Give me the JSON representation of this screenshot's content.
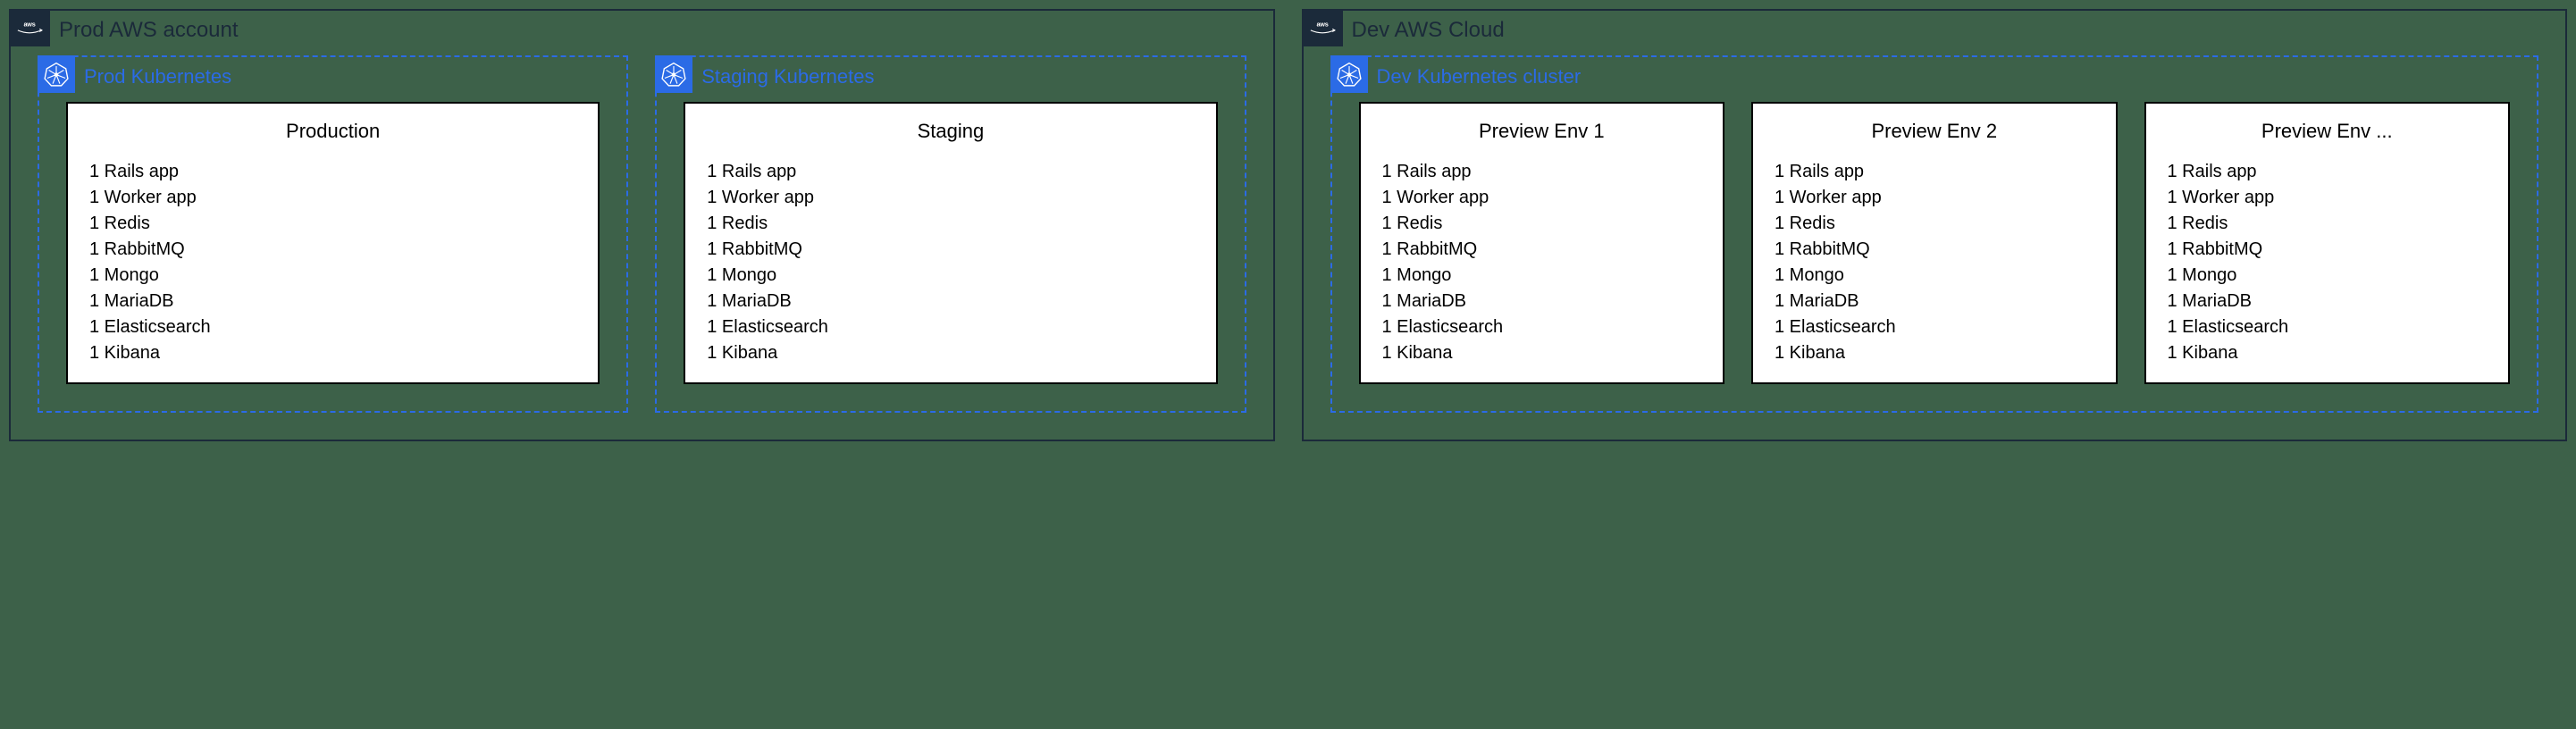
{
  "accounts": [
    {
      "id": "prod-account",
      "title": "Prod AWS account",
      "clusters": [
        {
          "id": "prod-k8s",
          "title": "Prod Kubernetes",
          "environments": [
            {
              "name": "Production",
              "items": [
                "1 Rails app",
                "1 Worker app",
                "1 Redis",
                "1 RabbitMQ",
                "1 Mongo",
                "1 MariaDB",
                "1 Elasticsearch",
                "1 Kibana"
              ]
            }
          ]
        },
        {
          "id": "staging-k8s",
          "title": "Staging Kubernetes",
          "environments": [
            {
              "name": "Staging",
              "items": [
                "1 Rails app",
                "1 Worker app",
                "1 Redis",
                "1 RabbitMQ",
                "1 Mongo",
                "1 MariaDB",
                "1 Elasticsearch",
                "1 Kibana"
              ]
            }
          ]
        }
      ]
    },
    {
      "id": "dev-account",
      "title": "Dev AWS Cloud",
      "clusters": [
        {
          "id": "dev-k8s",
          "title": "Dev Kubernetes cluster",
          "dev": true,
          "environments": [
            {
              "name": "Preview Env 1",
              "items": [
                "1 Rails app",
                "1 Worker app",
                "1 Redis",
                "1 RabbitMQ",
                "1 Mongo",
                "1 MariaDB",
                "1 Elasticsearch",
                "1 Kibana"
              ]
            },
            {
              "name": "Preview Env 2",
              "items": [
                "1 Rails app",
                "1 Worker app",
                "1 Redis",
                "1 RabbitMQ",
                "1 Mongo",
                "1 MariaDB",
                "1 Elasticsearch",
                "1 Kibana"
              ]
            },
            {
              "name": "Preview Env ...",
              "items": [
                "1 Rails app",
                "1 Worker app",
                "1 Redis",
                "1 RabbitMQ",
                "1 Mongo",
                "1 MariaDB",
                "1 Elasticsearch",
                "1 Kibana"
              ]
            }
          ]
        }
      ]
    }
  ]
}
